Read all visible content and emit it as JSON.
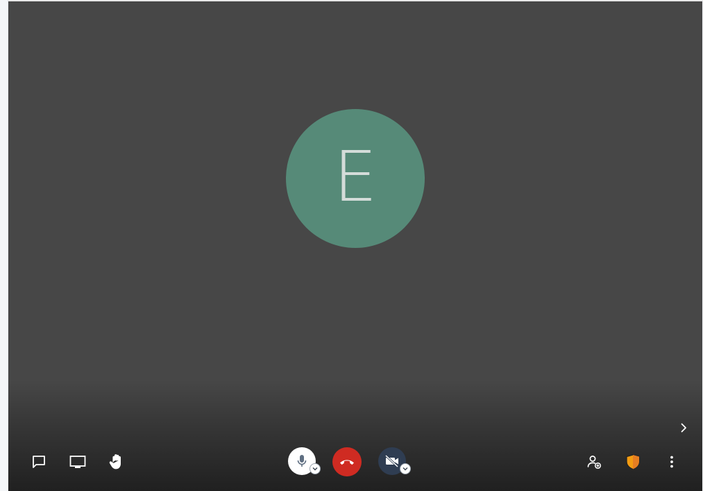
{
  "participant": {
    "initial": "E",
    "avatar_color": "#568a78"
  },
  "toolbar": {
    "left": [
      {
        "name": "chat-button",
        "icon": "chat-bubble-icon"
      },
      {
        "name": "share-screen-button",
        "icon": "screen-share-icon"
      },
      {
        "name": "raise-hand-button",
        "icon": "hand-icon"
      }
    ],
    "center": [
      {
        "name": "microphone-button",
        "icon": "microphone-icon",
        "state": "on"
      },
      {
        "name": "hangup-button",
        "icon": "hangup-icon",
        "color": "#cf2b22"
      },
      {
        "name": "camera-button",
        "icon": "camera-off-icon",
        "state": "off"
      }
    ],
    "right": [
      {
        "name": "invite-button",
        "icon": "add-person-icon"
      },
      {
        "name": "security-button",
        "icon": "shield-icon",
        "color": "#f39c12"
      },
      {
        "name": "more-button",
        "icon": "more-vertical-icon"
      }
    ]
  },
  "colors": {
    "stage_background": "#474747",
    "accent_shield": "#f39c12"
  }
}
